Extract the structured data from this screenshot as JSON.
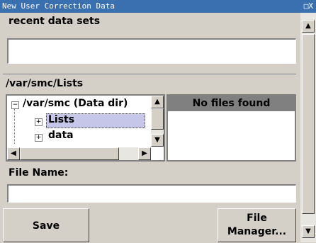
{
  "window": {
    "title": "New User Correction Data",
    "controls": "□X"
  },
  "recent": {
    "label": "recent data sets",
    "value": ""
  },
  "path": {
    "label": "/var/smc/Lists"
  },
  "tree": {
    "root": "/var/smc (Data dir)",
    "items": [
      {
        "label": "Lists",
        "selected": true
      },
      {
        "label": "data",
        "selected": false
      }
    ]
  },
  "files": {
    "header": "No files found"
  },
  "filename": {
    "label": "File Name:",
    "value": ""
  },
  "buttons": {
    "save": "Save",
    "manager_line1": "File",
    "manager_line2": "Manager..."
  },
  "colors": {
    "titlebar": "#3a6fb0",
    "selection": "#c6c6e8",
    "header": "#808080"
  }
}
